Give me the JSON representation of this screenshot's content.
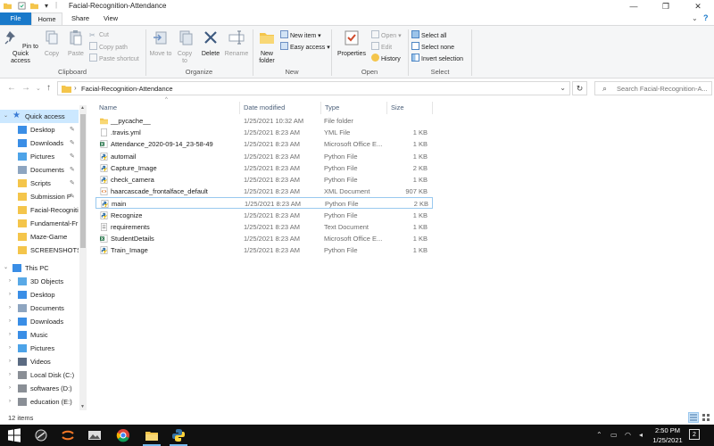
{
  "window": {
    "title": "Facial-Recognition-Attendance",
    "minimize": "—",
    "maximize": "❐",
    "close": "✕"
  },
  "ribbon": {
    "tabs": [
      "File",
      "Home",
      "Share",
      "View"
    ],
    "clipboard": {
      "label": "Clipboard",
      "pin": "Pin to Quick access",
      "copy": "Copy",
      "paste": "Paste",
      "cut": "Cut",
      "copy_path": "Copy path",
      "paste_shortcut": "Paste shortcut"
    },
    "organize": {
      "label": "Organize",
      "move_to": "Move to",
      "copy_to": "Copy to",
      "delete": "Delete",
      "rename": "Rename"
    },
    "new": {
      "label": "New",
      "new_folder": "New folder",
      "new_item": "New item",
      "easy_access": "Easy access"
    },
    "open": {
      "label": "Open",
      "properties": "Properties",
      "open": "Open",
      "edit": "Edit",
      "history": "History"
    },
    "select": {
      "label": "Select",
      "select_all": "Select all",
      "select_none": "Select none",
      "invert_selection": "Invert selection"
    }
  },
  "address": {
    "path": "Facial-Recognition-Attendance",
    "separator": "›",
    "search_placeholder": "Search Facial-Recognition-A..."
  },
  "nav": {
    "quick_access": "Quick access",
    "pinned": [
      "Desktop",
      "Downloads",
      "Pictures",
      "Documents",
      "Scripts",
      "Submission P"
    ],
    "recent": [
      "Facial-Recogniti",
      "Fundamental-Fr",
      "Maze-Game",
      "SCREENSHOTS"
    ],
    "this_pc": "This PC",
    "pc_items": [
      "3D Objects",
      "Desktop",
      "Documents",
      "Downloads",
      "Music",
      "Pictures",
      "Videos",
      "Local Disk (C:)",
      "softwares (D:)",
      "education (E:)"
    ]
  },
  "columns": {
    "name": "Name",
    "date": "Date modified",
    "type": "Type",
    "size": "Size"
  },
  "files": [
    {
      "name": "__pycache__",
      "date": "1/25/2021 10:32 AM",
      "type": "File folder",
      "size": "",
      "icon": "folder-icon"
    },
    {
      "name": ".travis.yml",
      "date": "1/25/2021 8:23 AM",
      "type": "YML File",
      "size": "1 KB",
      "icon": "file-icon"
    },
    {
      "name": "Attendance_2020-09-14_23-58-49",
      "date": "1/25/2021 8:23 AM",
      "type": "Microsoft Office E...",
      "size": "1 KB",
      "icon": "excel-icon"
    },
    {
      "name": "automail",
      "date": "1/25/2021 8:23 AM",
      "type": "Python File",
      "size": "1 KB",
      "icon": "python-icon"
    },
    {
      "name": "Capture_Image",
      "date": "1/25/2021 8:23 AM",
      "type": "Python File",
      "size": "2 KB",
      "icon": "python-icon"
    },
    {
      "name": "check_camera",
      "date": "1/25/2021 8:23 AM",
      "type": "Python File",
      "size": "1 KB",
      "icon": "python-icon"
    },
    {
      "name": "haarcascade_frontalface_default",
      "date": "1/25/2021 8:23 AM",
      "type": "XML Document",
      "size": "907 KB",
      "icon": "xml-icon"
    },
    {
      "name": "main",
      "date": "1/25/2021 8:23 AM",
      "type": "Python File",
      "size": "2 KB",
      "icon": "python-icon"
    },
    {
      "name": "Recognize",
      "date": "1/25/2021 8:23 AM",
      "type": "Python File",
      "size": "1 KB",
      "icon": "python-icon"
    },
    {
      "name": "requirements",
      "date": "1/25/2021 8:23 AM",
      "type": "Text Document",
      "size": "1 KB",
      "icon": "text-icon"
    },
    {
      "name": "StudentDetails",
      "date": "1/25/2021 8:23 AM",
      "type": "Microsoft Office E...",
      "size": "1 KB",
      "icon": "excel-icon"
    },
    {
      "name": "Train_Image",
      "date": "1/25/2021 8:23 AM",
      "type": "Python File",
      "size": "1 KB",
      "icon": "python-icon"
    }
  ],
  "status": {
    "item_count": "12 items"
  },
  "taskbar": {
    "time": "2:50 PM",
    "date": "1/25/2021",
    "notification_count": "2"
  },
  "colors": {
    "accent": "#1979ca",
    "folder": "#f4c54b",
    "taskbar": "#101010"
  }
}
